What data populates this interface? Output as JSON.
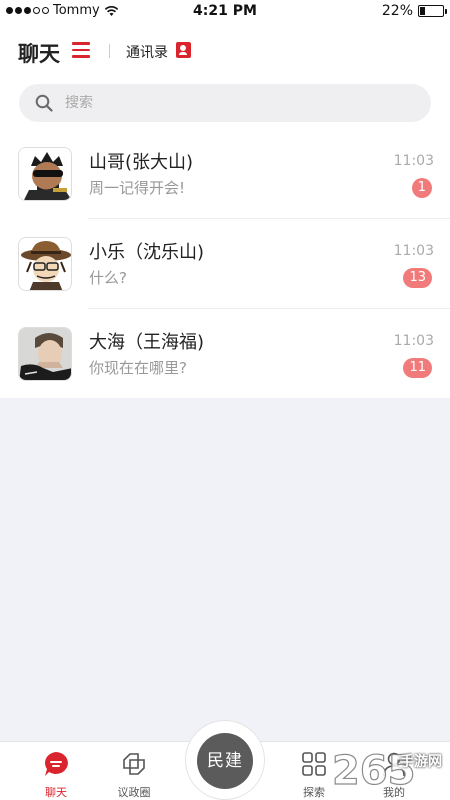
{
  "status_bar": {
    "carrier": "Tommy",
    "time": "4:21 PM",
    "battery_percent": "22%",
    "battery_level": 0.22,
    "signal_bars": 3
  },
  "header": {
    "chat_tab": "聊天",
    "contacts_tab": "通讯录",
    "accent_color": "#d9252d"
  },
  "search": {
    "placeholder": "搜索"
  },
  "chats": [
    {
      "name": "山哥(张大山)",
      "preview": "周一记得开会!",
      "time": "11:03",
      "unread": "1",
      "avatar": "avatar-sunglasses-man"
    },
    {
      "name": "小乐（沈乐山)",
      "preview": "什么?",
      "time": "11:03",
      "unread": "13",
      "avatar": "avatar-cowboy-hat-cartoon"
    },
    {
      "name": "大海（王海福)",
      "preview": "你现在在哪里?",
      "time": "11:03",
      "unread": "11",
      "avatar": "avatar-young-man"
    }
  ],
  "tabbar": {
    "chat": "聊天",
    "politics": "议政圈",
    "center": "民建",
    "explore": "探索",
    "mine": "我的"
  },
  "watermark": {
    "number": "265",
    "text": "手游网"
  }
}
